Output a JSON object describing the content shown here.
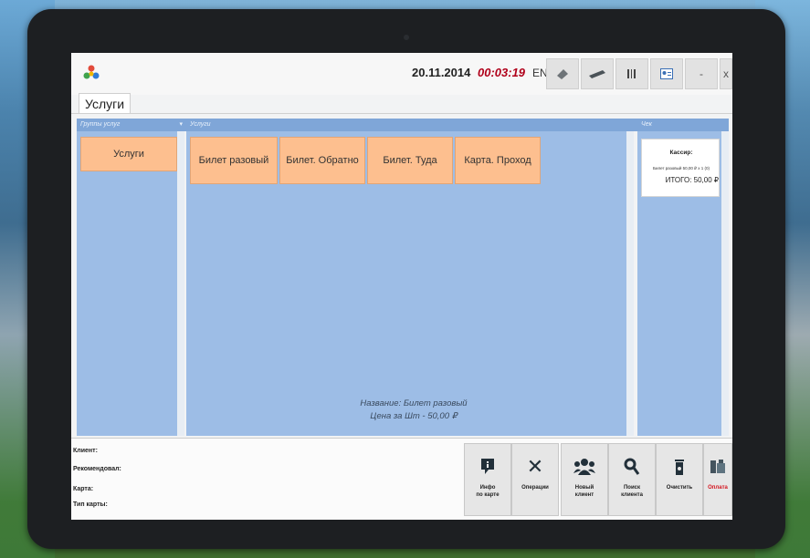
{
  "header": {
    "date": "20.11.2014",
    "time": "00:03:19",
    "lang": "EN",
    "toolbar_icons": [
      "scale-icon",
      "card-icon",
      "barcode-icon",
      "contact-card-icon",
      "minus-icon",
      "close-icon"
    ],
    "btn_minus": "-",
    "btn_close": "x"
  },
  "tab": {
    "label": "Услуги"
  },
  "groups": {
    "header": "Группы услуг",
    "items": [
      "Услуги"
    ]
  },
  "services": {
    "header": "Услуги",
    "items": [
      "Билет разовый",
      "Билет. Обратно",
      "Билет. Туда",
      "Карта. Проход"
    ],
    "caption_line1": "Название: Билет разовый",
    "caption_line2": "Цена за Шт - 50,00 ₽"
  },
  "check": {
    "header": "Чек",
    "cashier": "Кассир:",
    "line": "Билет разовый 50,00 ₽ x 1 (0)",
    "total": "ИТОГО: 50,00 ₽"
  },
  "client_info": {
    "client": "Клиент:",
    "recommended": "Рекомендовал:",
    "card": "Карта:",
    "card_type": "Тип карты:"
  },
  "actions": [
    {
      "label1": "Инфо",
      "label2": "по карте",
      "icon": "info-icon"
    },
    {
      "label1": "Операции",
      "label2": "",
      "icon": "tools-icon"
    },
    {
      "label1": "Новый",
      "label2": "клиент",
      "icon": "users-icon"
    },
    {
      "label1": "Поиск",
      "label2": "клиента",
      "icon": "search-icon"
    },
    {
      "label1": "Очистить",
      "label2": "",
      "icon": "trash-icon"
    },
    {
      "label1": "Оплата",
      "label2": "",
      "icon": "payment-icon"
    }
  ],
  "colors": {
    "panel": "#9dbde6",
    "tile": "#fdbf8f",
    "clock": "#b0001a",
    "pay_label": "#d4141e"
  }
}
